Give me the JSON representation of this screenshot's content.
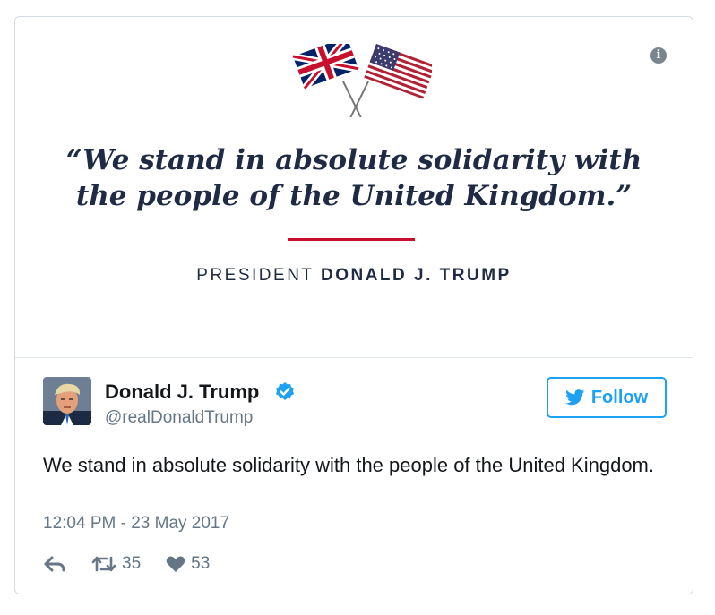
{
  "media": {
    "quote": "“We stand in absolute solidarity with the people of the United Kingdom.”",
    "attribution_prefix": "PRESIDENT",
    "attribution_name": "DONALD J. TRUMP",
    "icons": [
      "uk-flag-icon",
      "us-flag-icon",
      "info-icon"
    ]
  },
  "tweet": {
    "author_name": "Donald J. Trump",
    "author_handle": "@realDonaldTrump",
    "follow_label": "Follow",
    "text": "We stand in absolute solidarity with the people of the United Kingdom.",
    "timestamp": "12:04 PM - 23 May 2017",
    "retweets": "35",
    "likes": "53",
    "icons": [
      "verified-badge-icon",
      "twitter-bird-icon",
      "reply-icon",
      "retweet-icon",
      "heart-icon"
    ]
  },
  "colors": {
    "accent": "#1da1f2",
    "quote_text": "#1f2a44",
    "rule": "#c8102e",
    "muted": "#657786"
  }
}
